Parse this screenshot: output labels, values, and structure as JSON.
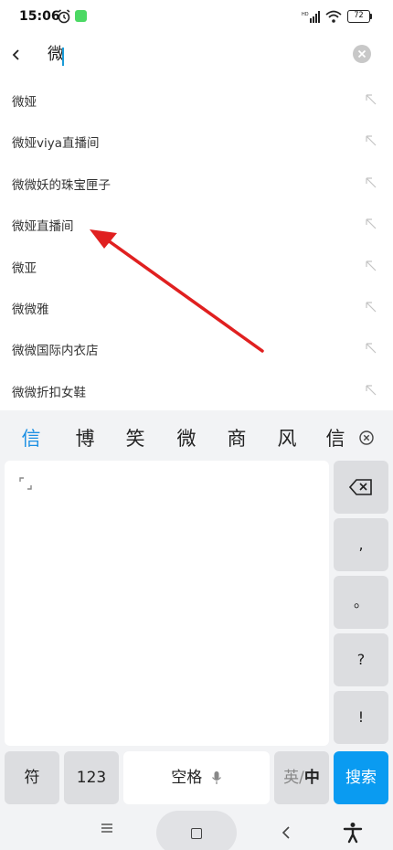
{
  "status_bar": {
    "time": "15:06",
    "battery": "72",
    "icons": [
      "alarm-icon",
      "app-notification-icon",
      "signal-icon",
      "wifi-icon",
      "battery-icon"
    ]
  },
  "search": {
    "query": "微",
    "back_icon": "back-arrow-icon",
    "clear_icon": "clear-icon"
  },
  "suggestions": [
    {
      "label": "微娅"
    },
    {
      "label": "微娅viya直播间"
    },
    {
      "label": "微微妖的珠宝匣子"
    },
    {
      "label": "微娅直播间"
    },
    {
      "label": "微亚"
    },
    {
      "label": "微微雅"
    },
    {
      "label": "微微国际内衣店"
    },
    {
      "label": "微微折扣女鞋"
    }
  ],
  "annotation": {
    "color": "#e02020"
  },
  "keyboard": {
    "candidates": [
      "信",
      "博",
      "笑",
      "微",
      "商",
      "风",
      "信"
    ],
    "side_keys": [
      ",",
      "。",
      "?",
      "!"
    ],
    "bottom": {
      "symbols": "符",
      "numbers": "123",
      "space": "空格",
      "lang_en": "英",
      "lang_sep": "/",
      "lang_zh": "中",
      "search": "搜索"
    },
    "accent": "#0a9bf1"
  },
  "nav": {
    "icons": [
      "menu-icon",
      "home-icon",
      "back-icon",
      "accessibility-icon"
    ]
  }
}
